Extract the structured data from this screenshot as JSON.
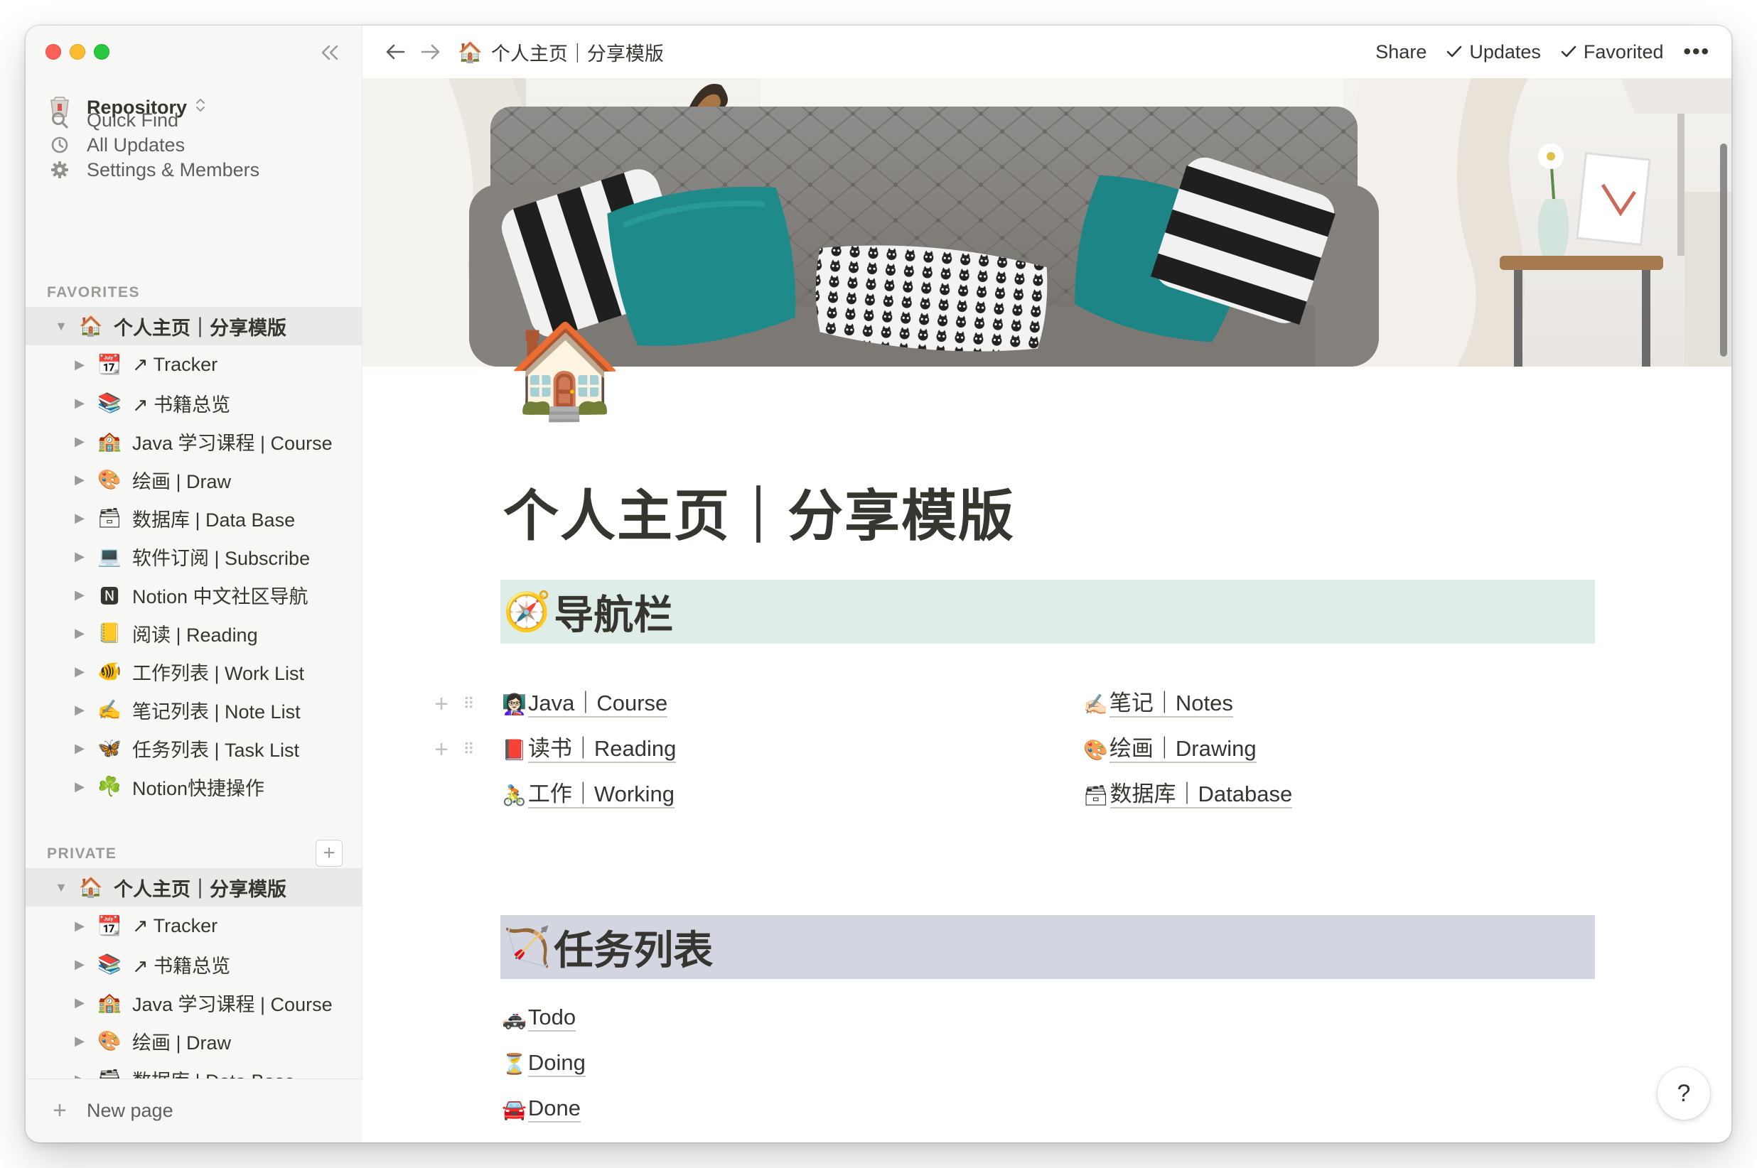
{
  "window": {
    "traffic_lights": [
      "close",
      "minimize",
      "zoom"
    ]
  },
  "sidebar": {
    "workspace": {
      "icon": "🗃",
      "name": "Repository"
    },
    "nav": [
      {
        "icon": "search-icon",
        "label": "Quick Find"
      },
      {
        "icon": "clock-icon",
        "label": "All Updates"
      },
      {
        "icon": "gear-icon",
        "label": "Settings & Members"
      }
    ],
    "favorites_label": "FAVORITES",
    "favorites": [
      {
        "emoji": "🏠",
        "label": "个人主页｜分享模版",
        "level": 0,
        "expanded": true
      },
      {
        "emoji": "📆",
        "label": "↗ Tracker",
        "level": 1
      },
      {
        "emoji": "📚",
        "label": "↗ 书籍总览",
        "level": 1
      },
      {
        "emoji": "🏫",
        "label": "Java 学习课程 | Course",
        "level": 1
      },
      {
        "emoji": "🎨",
        "label": "绘画 | Draw",
        "level": 1
      },
      {
        "emoji": "🗃",
        "label": "数据库 | Data Base",
        "level": 1
      },
      {
        "emoji": "💻",
        "label": "软件订阅 | Subscribe",
        "level": 1
      },
      {
        "emoji": "🅽",
        "label": "Notion 中文社区导航",
        "level": 1
      },
      {
        "emoji": "📒",
        "label": "阅读 | Reading",
        "level": 1
      },
      {
        "emoji": "🐠",
        "label": "工作列表 | Work List",
        "level": 1
      },
      {
        "emoji": "✍️",
        "label": "笔记列表 | Note List",
        "level": 1
      },
      {
        "emoji": "🦋",
        "label": "任务列表 | Task List",
        "level": 1
      },
      {
        "emoji": "☘️",
        "label": "Notion快捷操作",
        "level": 1
      }
    ],
    "private_label": "PRIVATE",
    "private": [
      {
        "emoji": "🏠",
        "label": "个人主页｜分享模版",
        "level": 0,
        "expanded": true
      },
      {
        "emoji": "📆",
        "label": "↗ Tracker",
        "level": 1
      },
      {
        "emoji": "📚",
        "label": "↗ 书籍总览",
        "level": 1
      },
      {
        "emoji": "🏫",
        "label": "Java 学习课程 | Course",
        "level": 1
      },
      {
        "emoji": "🎨",
        "label": "绘画 | Draw",
        "level": 1
      },
      {
        "emoji": "🗃",
        "label": "数据库 | Data Base",
        "level": 1
      }
    ],
    "new_page_label": "New page"
  },
  "topbar": {
    "breadcrumb": {
      "emoji": "🏠",
      "label": "个人主页｜分享模版"
    },
    "share_label": "Share",
    "updates_label": "Updates",
    "favorited_label": "Favorited",
    "more_label": "•••"
  },
  "page": {
    "icon": "🏠",
    "title": "个人主页｜分享模版",
    "nav_heading": {
      "emoji": "🧭",
      "text": "导航栏"
    },
    "nav_links_left": [
      {
        "emoji": "👩🏻‍🏫",
        "text": "Java｜Course"
      },
      {
        "emoji": "📕",
        "text": "读书｜Reading"
      },
      {
        "emoji": "🚴",
        "text": "工作｜Working"
      }
    ],
    "nav_links_right": [
      {
        "emoji": "✍🏻",
        "text": "笔记｜Notes"
      },
      {
        "emoji": "🎨",
        "text": "绘画｜Drawing"
      },
      {
        "emoji": "🗃",
        "text": "数据库｜Database"
      }
    ],
    "task_heading": {
      "emoji": "🏹",
      "text": "任务列表"
    },
    "task_links": [
      {
        "emoji": "🚓",
        "text": "Todo"
      },
      {
        "emoji": "⏳",
        "text": "Doing"
      },
      {
        "emoji": "🚘",
        "text": "Done"
      }
    ]
  },
  "help_label": "?"
}
